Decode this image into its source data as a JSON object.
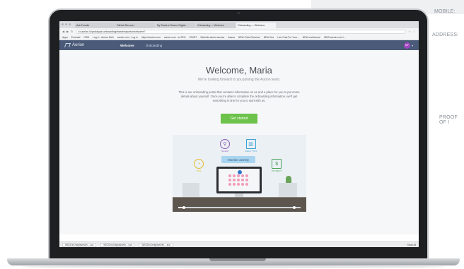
{
  "side_form": {
    "labels": [
      "MOBILE:",
      "ADDRESS:",
      "PROOF OF I"
    ]
  },
  "browser": {
    "tabs": [
      "Ask Funsite",
      "GitHub Recover",
      "My Tasks in Brand, Digital...",
      "Onboarding — Welcome",
      "Onboarding — Welcome"
    ],
    "url": "cx.aurion.io/prototype-onboarding/master/aportonwelcome?",
    "bookmarks": [
      "Apps",
      "Emerald",
      "CRM",
      "Log in - Aurion Web",
      "aurion.com - Log in",
      "https://aurion.com",
      "aurion.com - to SEO",
      "START",
      "Website admin access",
      "Asana",
      "NEW Citrix Receiver",
      "NEW Jira",
      "Live Chat For Your...",
      "NEW confluence",
      "NEW aurion.com t..."
    ]
  },
  "app": {
    "logo_text": "Aurion",
    "nav": [
      "Welcome",
      "Onboarding"
    ],
    "avatar_initials": "MF"
  },
  "welcome": {
    "title": "Welcome, Maria",
    "subtitle": "We're looking forward to you joining the Aurion team.",
    "body": "This is our onboarding portal that contains information on us and a place for you to put some details about yourself. Once you're able to complete the onboarding information, we'll get everything in line for you to start with us.",
    "cta": "Get started"
  },
  "illustration": {
    "pill": "Monitor activity",
    "features": [
      "TALENT",
      "ANALYTICS",
      "TIME",
      "PAYMENT"
    ]
  },
  "downloads": {
    "items": [
      "WEDDInOnlightselveh....sva",
      "WEDDInOnlightselveh....sva",
      "WEDDInOnlightselveh....sva"
    ],
    "show_all": "Show All"
  },
  "colors": {
    "header": "#4a5a78",
    "cta": "#6cc24a",
    "avatar": "#a245c2",
    "talent_icon": "#8e56b8",
    "analytics_icon": "#3ba0d6",
    "time_icon": "#e3bc2c",
    "payment_icon": "#4aa05a"
  }
}
